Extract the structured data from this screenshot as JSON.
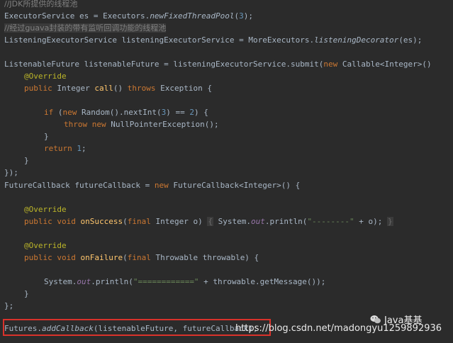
{
  "code": {
    "l1": "//JDK所提供的线程池",
    "l2a": "ExecutorService es = Executors.",
    "l2b": "newFixedThreadPool",
    "l2c": "(",
    "l2d": "3",
    "l2e": ");",
    "l3": "//经过guava封装的带有监听回调功能的线程池",
    "l4a": "ListeningExecutorService listeningExecutorService = MoreExecutors.",
    "l4b": "listeningDecorator",
    "l4c": "(es);",
    "l5a": "ListenableFuture listenableFuture = listeningExecutorService.submit(",
    "l5b": "new",
    "l5c": " Callable<Integer>()",
    "l6": "@Override",
    "l7a": "public",
    "l7b": " Integer ",
    "l7c": "call",
    "l7d": "() ",
    "l7e": "throws",
    "l7f": " Exception {",
    "l8a": "if",
    "l8b": " (",
    "l8c": "new",
    "l8d": " Random().nextInt(",
    "l8e": "3",
    "l8f": ") == ",
    "l8g": "2",
    "l8h": ") {",
    "l9a": "throw",
    "l9b": " ",
    "l9c": "new",
    "l9d": " NullPointerException();",
    "l10": "}",
    "l11a": "return",
    "l11b": " ",
    "l11c": "1",
    "l11d": ";",
    "l12": "}",
    "l13": "});",
    "l14a": "FutureCallback futureCallback = ",
    "l14b": "new",
    "l14c": " FutureCallback<Integer>() {",
    "l15": "@Override",
    "l16a": "public",
    "l16b": " ",
    "l16c": "void",
    "l16d": " ",
    "l16e": "onSuccess",
    "l16f": "(",
    "l16g": "final",
    "l16h": " Integer o) ",
    "l16i": "{",
    "l16j": " System.",
    "l16k": "out",
    "l16l": ".println(",
    "l16m": "\"--------\"",
    "l16n": " + o); ",
    "l16o": "}",
    "l17": "@Override",
    "l18a": "public",
    "l18b": " ",
    "l18c": "void",
    "l18d": " ",
    "l18e": "onFailure",
    "l18f": "(",
    "l18g": "final",
    "l18h": " Throwable throwable) {",
    "l19a": "System.",
    "l19b": "out",
    "l19c": ".println(",
    "l19d": "\"============\"",
    "l19e": " + throwable.getMessage());",
    "l20": "}",
    "l21": "};",
    "l22a": "Futures.",
    "l22b": "addCallback",
    "l22c": "(listenableFuture, futureCallback);"
  },
  "overlay": {
    "watermark": "https://blog.csdn.net/madongyu1259892936",
    "badge_text": "Java基基",
    "badge_icon": "wechat-icon"
  },
  "colors": {
    "background": "#2b2b2b",
    "keyword": "#cc7832",
    "annotation": "#bbb529",
    "number": "#6897bb",
    "string": "#6a8759",
    "comment": "#808080",
    "highlight_border": "#d9322b"
  }
}
